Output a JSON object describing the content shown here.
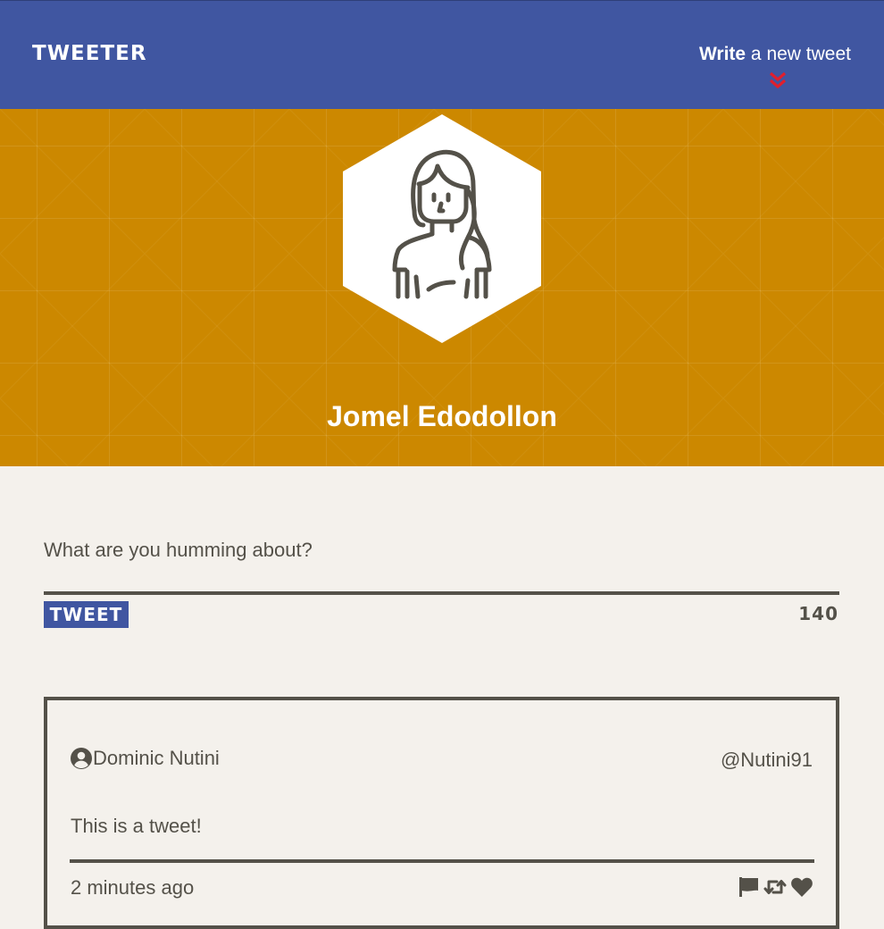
{
  "nav": {
    "brand": "TWEETER",
    "compose_strong": "Write",
    "compose_rest": " a new tweet",
    "chevron_icon": "double-chevron-down-icon",
    "chevron_color": "#e01f2d"
  },
  "profile": {
    "name": "Jomel Edodollon",
    "avatar_icon": "woman-avatar-icon",
    "background_color": "#cc8800"
  },
  "compose": {
    "placeholder": "What are you humming about?",
    "button_label": "TWEET",
    "counter": "140"
  },
  "tweet": {
    "author": "Dominic Nutini",
    "handle": "@Nutini91",
    "body": "This is a tweet!",
    "time": "2 minutes ago",
    "actions": [
      "flag-icon",
      "retweet-icon",
      "heart-icon"
    ]
  },
  "colors": {
    "nav_bg": "#4056a1",
    "page_bg": "#f4f1ec",
    "text": "#545149",
    "accent": "#cc8800"
  }
}
